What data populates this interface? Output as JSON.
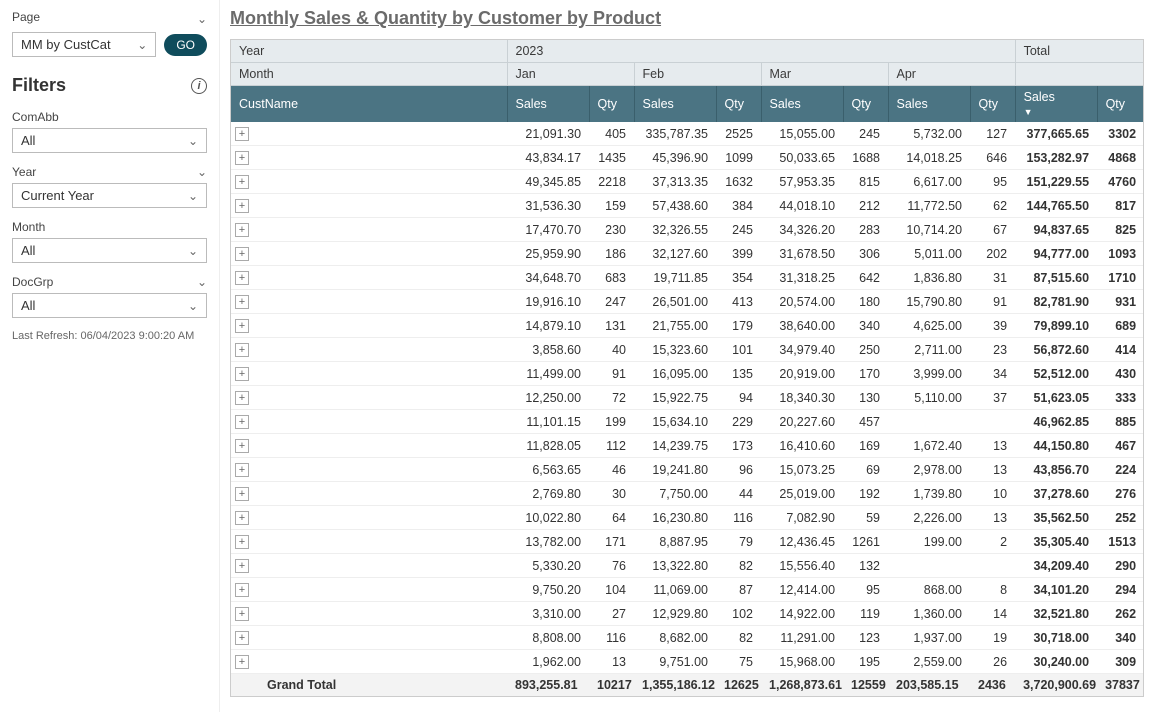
{
  "sidebar": {
    "pageLabel": "Page",
    "pageSelected": "MM by CustCat",
    "goLabel": "GO",
    "filtersHeading": "Filters",
    "filters": [
      {
        "label": "ComAbb",
        "value": "All",
        "collapsible": false
      },
      {
        "label": "Year",
        "value": "Current Year",
        "collapsible": true
      },
      {
        "label": "Month",
        "value": "All",
        "collapsible": false
      },
      {
        "label": "DocGrp",
        "value": "All",
        "collapsible": true
      }
    ],
    "lastRefresh": "Last Refresh: 06/04/2023 9:00:20 AM"
  },
  "title": "Monthly Sales & Quantity by Customer by Product",
  "headers": {
    "yearLabel": "Year",
    "yearValue": "2023",
    "monthLabel": "Month",
    "months": [
      "Jan",
      "Feb",
      "Mar",
      "Apr"
    ],
    "totalLabel": "Total",
    "custNameLabel": "CustName",
    "salesLabel": "Sales",
    "qtyLabel": "Qty"
  },
  "rows": [
    {
      "s1": "21,091.30",
      "q1": "405",
      "s2": "335,787.35",
      "q2": "2525",
      "s3": "15,055.00",
      "q3": "245",
      "s4": "5,732.00",
      "q4": "127",
      "ts": "377,665.65",
      "tq": "3302"
    },
    {
      "s1": "43,834.17",
      "q1": "1435",
      "s2": "45,396.90",
      "q2": "1099",
      "s3": "50,033.65",
      "q3": "1688",
      "s4": "14,018.25",
      "q4": "646",
      "ts": "153,282.97",
      "tq": "4868"
    },
    {
      "s1": "49,345.85",
      "q1": "2218",
      "s2": "37,313.35",
      "q2": "1632",
      "s3": "57,953.35",
      "q3": "815",
      "s4": "6,617.00",
      "q4": "95",
      "ts": "151,229.55",
      "tq": "4760"
    },
    {
      "s1": "31,536.30",
      "q1": "159",
      "s2": "57,438.60",
      "q2": "384",
      "s3": "44,018.10",
      "q3": "212",
      "s4": "11,772.50",
      "q4": "62",
      "ts": "144,765.50",
      "tq": "817"
    },
    {
      "s1": "17,470.70",
      "q1": "230",
      "s2": "32,326.55",
      "q2": "245",
      "s3": "34,326.20",
      "q3": "283",
      "s4": "10,714.20",
      "q4": "67",
      "ts": "94,837.65",
      "tq": "825"
    },
    {
      "s1": "25,959.90",
      "q1": "186",
      "s2": "32,127.60",
      "q2": "399",
      "s3": "31,678.50",
      "q3": "306",
      "s4": "5,011.00",
      "q4": "202",
      "ts": "94,777.00",
      "tq": "1093"
    },
    {
      "s1": "34,648.70",
      "q1": "683",
      "s2": "19,711.85",
      "q2": "354",
      "s3": "31,318.25",
      "q3": "642",
      "s4": "1,836.80",
      "q4": "31",
      "ts": "87,515.60",
      "tq": "1710"
    },
    {
      "s1": "19,916.10",
      "q1": "247",
      "s2": "26,501.00",
      "q2": "413",
      "s3": "20,574.00",
      "q3": "180",
      "s4": "15,790.80",
      "q4": "91",
      "ts": "82,781.90",
      "tq": "931"
    },
    {
      "s1": "14,879.10",
      "q1": "131",
      "s2": "21,755.00",
      "q2": "179",
      "s3": "38,640.00",
      "q3": "340",
      "s4": "4,625.00",
      "q4": "39",
      "ts": "79,899.10",
      "tq": "689"
    },
    {
      "s1": "3,858.60",
      "q1": "40",
      "s2": "15,323.60",
      "q2": "101",
      "s3": "34,979.40",
      "q3": "250",
      "s4": "2,711.00",
      "q4": "23",
      "ts": "56,872.60",
      "tq": "414"
    },
    {
      "s1": "11,499.00",
      "q1": "91",
      "s2": "16,095.00",
      "q2": "135",
      "s3": "20,919.00",
      "q3": "170",
      "s4": "3,999.00",
      "q4": "34",
      "ts": "52,512.00",
      "tq": "430"
    },
    {
      "s1": "12,250.00",
      "q1": "72",
      "s2": "15,922.75",
      "q2": "94",
      "s3": "18,340.30",
      "q3": "130",
      "s4": "5,110.00",
      "q4": "37",
      "ts": "51,623.05",
      "tq": "333"
    },
    {
      "s1": "11,101.15",
      "q1": "199",
      "s2": "15,634.10",
      "q2": "229",
      "s3": "20,227.60",
      "q3": "457",
      "s4": "",
      "q4": "",
      "ts": "46,962.85",
      "tq": "885"
    },
    {
      "s1": "11,828.05",
      "q1": "112",
      "s2": "14,239.75",
      "q2": "173",
      "s3": "16,410.60",
      "q3": "169",
      "s4": "1,672.40",
      "q4": "13",
      "ts": "44,150.80",
      "tq": "467"
    },
    {
      "s1": "6,563.65",
      "q1": "46",
      "s2": "19,241.80",
      "q2": "96",
      "s3": "15,073.25",
      "q3": "69",
      "s4": "2,978.00",
      "q4": "13",
      "ts": "43,856.70",
      "tq": "224"
    },
    {
      "s1": "2,769.80",
      "q1": "30",
      "s2": "7,750.00",
      "q2": "44",
      "s3": "25,019.00",
      "q3": "192",
      "s4": "1,739.80",
      "q4": "10",
      "ts": "37,278.60",
      "tq": "276"
    },
    {
      "s1": "10,022.80",
      "q1": "64",
      "s2": "16,230.80",
      "q2": "116",
      "s3": "7,082.90",
      "q3": "59",
      "s4": "2,226.00",
      "q4": "13",
      "ts": "35,562.50",
      "tq": "252"
    },
    {
      "s1": "13,782.00",
      "q1": "171",
      "s2": "8,887.95",
      "q2": "79",
      "s3": "12,436.45",
      "q3": "1261",
      "s4": "199.00",
      "q4": "2",
      "ts": "35,305.40",
      "tq": "1513"
    },
    {
      "s1": "5,330.20",
      "q1": "76",
      "s2": "13,322.80",
      "q2": "82",
      "s3": "15,556.40",
      "q3": "132",
      "s4": "",
      "q4": "",
      "ts": "34,209.40",
      "tq": "290"
    },
    {
      "s1": "9,750.20",
      "q1": "104",
      "s2": "11,069.00",
      "q2": "87",
      "s3": "12,414.00",
      "q3": "95",
      "s4": "868.00",
      "q4": "8",
      "ts": "34,101.20",
      "tq": "294"
    },
    {
      "s1": "3,310.00",
      "q1": "27",
      "s2": "12,929.80",
      "q2": "102",
      "s3": "14,922.00",
      "q3": "119",
      "s4": "1,360.00",
      "q4": "14",
      "ts": "32,521.80",
      "tq": "262"
    },
    {
      "s1": "8,808.00",
      "q1": "116",
      "s2": "8,682.00",
      "q2": "82",
      "s3": "11,291.00",
      "q3": "123",
      "s4": "1,937.00",
      "q4": "19",
      "ts": "30,718.00",
      "tq": "340"
    },
    {
      "s1": "1,962.00",
      "q1": "13",
      "s2": "9,751.00",
      "q2": "75",
      "s3": "15,968.00",
      "q3": "195",
      "s4": "2,559.00",
      "q4": "26",
      "ts": "30,240.00",
      "tq": "309"
    }
  ],
  "grandTotal": {
    "label": "Grand Total",
    "s1": "893,255.81",
    "q1": "10217",
    "s2": "1,355,186.12",
    "q2": "12625",
    "s3": "1,268,873.61",
    "q3": "12559",
    "s4": "203,585.15",
    "q4": "2436",
    "ts": "3,720,900.69",
    "tq": "37837"
  }
}
